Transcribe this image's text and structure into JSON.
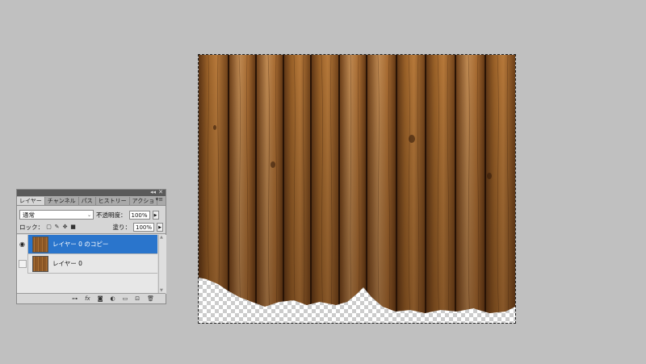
{
  "panel": {
    "tabs": [
      "レイヤー",
      "チャンネル",
      "パス",
      "ヒストリー",
      "アクショ"
    ],
    "blend_mode": "通常",
    "opacity_label": "不透明度：",
    "opacity_value": "100%",
    "lock_label": "ロック：",
    "fill_label": "塗り：",
    "fill_value": "100%",
    "layers": [
      {
        "name": "レイヤー 0 のコピー",
        "visible": true,
        "selected": true
      },
      {
        "name": "レイヤー 0",
        "visible": false,
        "selected": false
      }
    ]
  },
  "colors": {
    "canvas_bg": "#c0c0c0",
    "selection": "#2a75cc",
    "wood_dark": "#6a3e18",
    "wood_light": "#c08850"
  },
  "icons": {
    "panel": [
      "collapse-icon",
      "close-icon",
      "panel-menu-icon"
    ],
    "lock": [
      "lock-transparent-icon",
      "lock-brush-icon",
      "lock-move-icon",
      "lock-all-icon"
    ],
    "bottom": [
      "link-icon",
      "fx-icon",
      "mask-icon",
      "adjustment-icon",
      "group-folder-icon",
      "new-layer-icon",
      "trash-icon"
    ]
  }
}
